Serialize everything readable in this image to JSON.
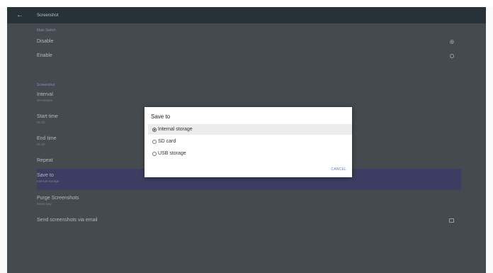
{
  "toolbar": {
    "title": "Screenshot",
    "back_icon": "arrow-back-icon"
  },
  "settings": {
    "main_switch": {
      "label": "Main Switch",
      "options": [
        {
          "title": "Disable",
          "selected": true
        },
        {
          "title": "Enable",
          "selected": false
        }
      ]
    },
    "screenshot": {
      "label": "Screenshot",
      "interval": {
        "title": "Interval",
        "value": "30 minutes"
      },
      "start_time": {
        "title": "Start time",
        "value": "01:33"
      },
      "end_time": {
        "title": "End time",
        "value": "01:34"
      },
      "repeat": {
        "title": "Repeat"
      },
      "save_to": {
        "title": "Save to",
        "value": "Internal storage"
      },
      "purge": {
        "title": "Purge Screenshots",
        "value": "Every Day"
      },
      "email": {
        "title": "Send screenshots via email",
        "checked": false
      }
    }
  },
  "dialog": {
    "title": "Save to",
    "options": [
      {
        "label": "Internal storage",
        "selected": true
      },
      {
        "label": "SD card",
        "selected": false
      },
      {
        "label": "USB storage",
        "selected": false
      }
    ],
    "cancel_label": "CANCEL"
  },
  "colors": {
    "toolbar": "#263238",
    "background": "#444a4e",
    "selected_row": "#3b3e62",
    "accent": "#5b7fb8"
  }
}
